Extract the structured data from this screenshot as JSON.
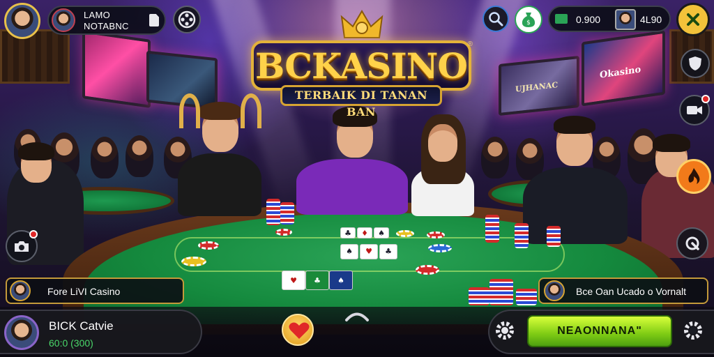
{
  "logo": {
    "title": "BCKASINO",
    "registered": "®",
    "subtitle": "TERBAIK DI TANAN BAN"
  },
  "top_left": {
    "profile_icon": "avatar-icon",
    "name_line1": "LAMO",
    "name_line2": "NOTABNC",
    "document_icon": "document-icon",
    "reel_icon": "film-reel-icon"
  },
  "top_right": {
    "search_icon": "search-user-icon",
    "bag_icon": "money-bag-icon",
    "balance_1": "0.900",
    "balance_2": "4L90",
    "close_icon": "close-icon"
  },
  "side_buttons": {
    "shield_icon": "shield-icon",
    "video_icon": "video-camera-icon",
    "fire_icon": "fire-icon",
    "tool_icon": "wrench-icon",
    "camera_icon": "camera-icon"
  },
  "tv_screens": {
    "left_text": "",
    "right_mid_text": "UJHANAC",
    "right_text": "Okasino"
  },
  "banners": {
    "left": "Fore LiVI Casino",
    "right": "Bce Oan Ucado o Vornalt"
  },
  "bottom": {
    "player_name": "BICK Catvie",
    "player_chips": "60:0 (300)",
    "heart_icon": "heart-icon",
    "chevron_icon": "chevron-up-icon",
    "gear_icon": "gear-icon",
    "cta_label": "NEAONNANA\""
  },
  "colors": {
    "gold": "#e3b23a",
    "felt": "#158a3e",
    "cta_green": "#7ecb14",
    "accent_orange": "#f27a1a"
  }
}
